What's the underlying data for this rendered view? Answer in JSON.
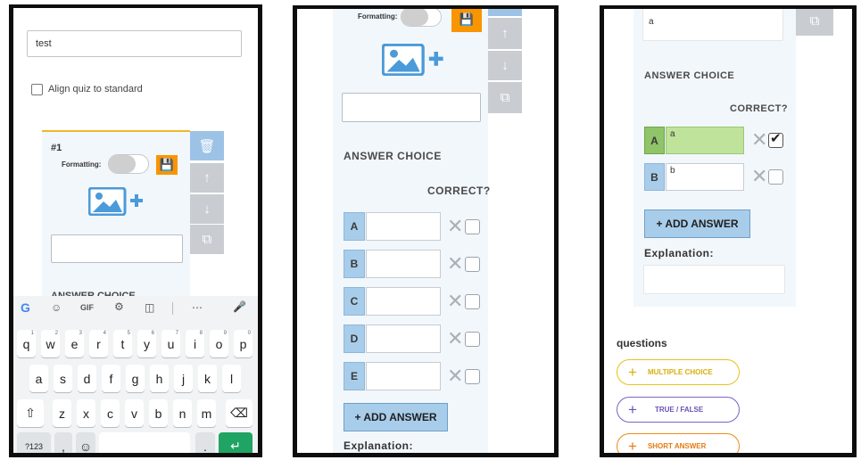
{
  "screen1": {
    "title_value": "test",
    "align_label": "Align quiz to standard",
    "question_number": "#1",
    "formatting_label": "Formatting:",
    "answer_choice_partial": "ANSWER CHOICE",
    "keyboard": {
      "row1": [
        "q",
        "w",
        "e",
        "r",
        "t",
        "y",
        "u",
        "i",
        "o",
        "p"
      ],
      "row1_nums": [
        "1",
        "2",
        "3",
        "4",
        "5",
        "6",
        "7",
        "8",
        "9",
        "0"
      ],
      "row2": [
        "a",
        "s",
        "d",
        "f",
        "g",
        "h",
        "j",
        "k",
        "l"
      ],
      "row3": [
        "z",
        "x",
        "c",
        "v",
        "b",
        "n",
        "m"
      ],
      "mode_key": "?123",
      "comma_key": ",",
      "period_key": ".",
      "gif_label": "GIF"
    }
  },
  "screen2": {
    "formatting_label": "Formatting:",
    "answer_choice_heading": "ANSWER CHOICE",
    "correct_heading": "CORRECT?",
    "choices": [
      "A",
      "B",
      "C",
      "D",
      "E"
    ],
    "add_answer": "+ ADD ANSWER",
    "explanation": "Explanation:"
  },
  "screen3": {
    "field_value": "a",
    "answer_choice_heading": "ANSWER CHOICE",
    "correct_heading": "CORRECT?",
    "choices": [
      {
        "letter": "A",
        "value": "a",
        "correct": true
      },
      {
        "letter": "B",
        "value": "b",
        "correct": false
      }
    ],
    "add_answer": "+ ADD ANSWER",
    "explanation": "Explanation:",
    "questions_label": "questions",
    "types": [
      "MULTIPLE CHOICE",
      "TRUE / FALSE",
      "SHORT ANSWER"
    ],
    "colors": {
      "multiple": "#e8c21a",
      "truefalse": "#7c63c6",
      "short": "#f08a1c"
    }
  },
  "colors": {
    "accent_orange": "#f99500",
    "answer_blue": "#a8cdea",
    "correct_green": "#bfe39a",
    "keyboard_green": "#1fa463"
  }
}
